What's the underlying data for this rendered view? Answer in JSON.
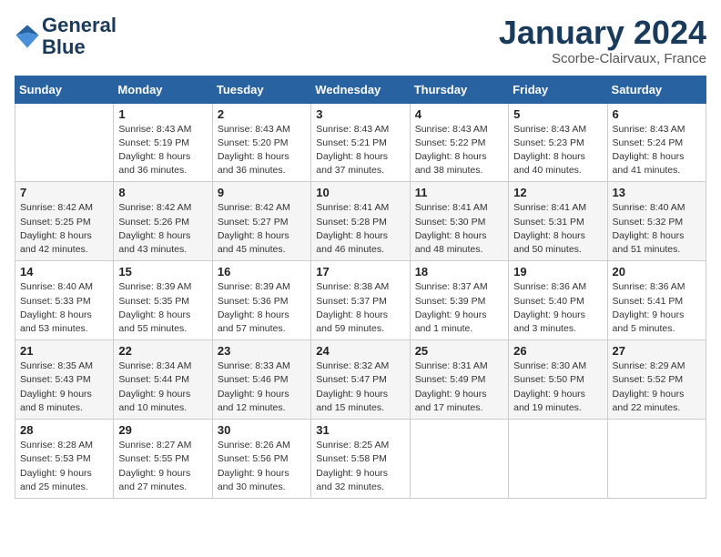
{
  "logo": {
    "line1": "General",
    "line2": "Blue"
  },
  "title": "January 2024",
  "subtitle": "Scorbe-Clairvaux, France",
  "headers": [
    "Sunday",
    "Monday",
    "Tuesday",
    "Wednesday",
    "Thursday",
    "Friday",
    "Saturday"
  ],
  "weeks": [
    [
      {
        "day": "",
        "sunrise": "",
        "sunset": "",
        "daylight": ""
      },
      {
        "day": "1",
        "sunrise": "Sunrise: 8:43 AM",
        "sunset": "Sunset: 5:19 PM",
        "daylight": "Daylight: 8 hours and 36 minutes."
      },
      {
        "day": "2",
        "sunrise": "Sunrise: 8:43 AM",
        "sunset": "Sunset: 5:20 PM",
        "daylight": "Daylight: 8 hours and 36 minutes."
      },
      {
        "day": "3",
        "sunrise": "Sunrise: 8:43 AM",
        "sunset": "Sunset: 5:21 PM",
        "daylight": "Daylight: 8 hours and 37 minutes."
      },
      {
        "day": "4",
        "sunrise": "Sunrise: 8:43 AM",
        "sunset": "Sunset: 5:22 PM",
        "daylight": "Daylight: 8 hours and 38 minutes."
      },
      {
        "day": "5",
        "sunrise": "Sunrise: 8:43 AM",
        "sunset": "Sunset: 5:23 PM",
        "daylight": "Daylight: 8 hours and 40 minutes."
      },
      {
        "day": "6",
        "sunrise": "Sunrise: 8:43 AM",
        "sunset": "Sunset: 5:24 PM",
        "daylight": "Daylight: 8 hours and 41 minutes."
      }
    ],
    [
      {
        "day": "7",
        "sunrise": "Sunrise: 8:42 AM",
        "sunset": "Sunset: 5:25 PM",
        "daylight": "Daylight: 8 hours and 42 minutes."
      },
      {
        "day": "8",
        "sunrise": "Sunrise: 8:42 AM",
        "sunset": "Sunset: 5:26 PM",
        "daylight": "Daylight: 8 hours and 43 minutes."
      },
      {
        "day": "9",
        "sunrise": "Sunrise: 8:42 AM",
        "sunset": "Sunset: 5:27 PM",
        "daylight": "Daylight: 8 hours and 45 minutes."
      },
      {
        "day": "10",
        "sunrise": "Sunrise: 8:41 AM",
        "sunset": "Sunset: 5:28 PM",
        "daylight": "Daylight: 8 hours and 46 minutes."
      },
      {
        "day": "11",
        "sunrise": "Sunrise: 8:41 AM",
        "sunset": "Sunset: 5:30 PM",
        "daylight": "Daylight: 8 hours and 48 minutes."
      },
      {
        "day": "12",
        "sunrise": "Sunrise: 8:41 AM",
        "sunset": "Sunset: 5:31 PM",
        "daylight": "Daylight: 8 hours and 50 minutes."
      },
      {
        "day": "13",
        "sunrise": "Sunrise: 8:40 AM",
        "sunset": "Sunset: 5:32 PM",
        "daylight": "Daylight: 8 hours and 51 minutes."
      }
    ],
    [
      {
        "day": "14",
        "sunrise": "Sunrise: 8:40 AM",
        "sunset": "Sunset: 5:33 PM",
        "daylight": "Daylight: 8 hours and 53 minutes."
      },
      {
        "day": "15",
        "sunrise": "Sunrise: 8:39 AM",
        "sunset": "Sunset: 5:35 PM",
        "daylight": "Daylight: 8 hours and 55 minutes."
      },
      {
        "day": "16",
        "sunrise": "Sunrise: 8:39 AM",
        "sunset": "Sunset: 5:36 PM",
        "daylight": "Daylight: 8 hours and 57 minutes."
      },
      {
        "day": "17",
        "sunrise": "Sunrise: 8:38 AM",
        "sunset": "Sunset: 5:37 PM",
        "daylight": "Daylight: 8 hours and 59 minutes."
      },
      {
        "day": "18",
        "sunrise": "Sunrise: 8:37 AM",
        "sunset": "Sunset: 5:39 PM",
        "daylight": "Daylight: 9 hours and 1 minute."
      },
      {
        "day": "19",
        "sunrise": "Sunrise: 8:36 AM",
        "sunset": "Sunset: 5:40 PM",
        "daylight": "Daylight: 9 hours and 3 minutes."
      },
      {
        "day": "20",
        "sunrise": "Sunrise: 8:36 AM",
        "sunset": "Sunset: 5:41 PM",
        "daylight": "Daylight: 9 hours and 5 minutes."
      }
    ],
    [
      {
        "day": "21",
        "sunrise": "Sunrise: 8:35 AM",
        "sunset": "Sunset: 5:43 PM",
        "daylight": "Daylight: 9 hours and 8 minutes."
      },
      {
        "day": "22",
        "sunrise": "Sunrise: 8:34 AM",
        "sunset": "Sunset: 5:44 PM",
        "daylight": "Daylight: 9 hours and 10 minutes."
      },
      {
        "day": "23",
        "sunrise": "Sunrise: 8:33 AM",
        "sunset": "Sunset: 5:46 PM",
        "daylight": "Daylight: 9 hours and 12 minutes."
      },
      {
        "day": "24",
        "sunrise": "Sunrise: 8:32 AM",
        "sunset": "Sunset: 5:47 PM",
        "daylight": "Daylight: 9 hours and 15 minutes."
      },
      {
        "day": "25",
        "sunrise": "Sunrise: 8:31 AM",
        "sunset": "Sunset: 5:49 PM",
        "daylight": "Daylight: 9 hours and 17 minutes."
      },
      {
        "day": "26",
        "sunrise": "Sunrise: 8:30 AM",
        "sunset": "Sunset: 5:50 PM",
        "daylight": "Daylight: 9 hours and 19 minutes."
      },
      {
        "day": "27",
        "sunrise": "Sunrise: 8:29 AM",
        "sunset": "Sunset: 5:52 PM",
        "daylight": "Daylight: 9 hours and 22 minutes."
      }
    ],
    [
      {
        "day": "28",
        "sunrise": "Sunrise: 8:28 AM",
        "sunset": "Sunset: 5:53 PM",
        "daylight": "Daylight: 9 hours and 25 minutes."
      },
      {
        "day": "29",
        "sunrise": "Sunrise: 8:27 AM",
        "sunset": "Sunset: 5:55 PM",
        "daylight": "Daylight: 9 hours and 27 minutes."
      },
      {
        "day": "30",
        "sunrise": "Sunrise: 8:26 AM",
        "sunset": "Sunset: 5:56 PM",
        "daylight": "Daylight: 9 hours and 30 minutes."
      },
      {
        "day": "31",
        "sunrise": "Sunrise: 8:25 AM",
        "sunset": "Sunset: 5:58 PM",
        "daylight": "Daylight: 9 hours and 32 minutes."
      },
      {
        "day": "",
        "sunrise": "",
        "sunset": "",
        "daylight": ""
      },
      {
        "day": "",
        "sunrise": "",
        "sunset": "",
        "daylight": ""
      },
      {
        "day": "",
        "sunrise": "",
        "sunset": "",
        "daylight": ""
      }
    ]
  ]
}
